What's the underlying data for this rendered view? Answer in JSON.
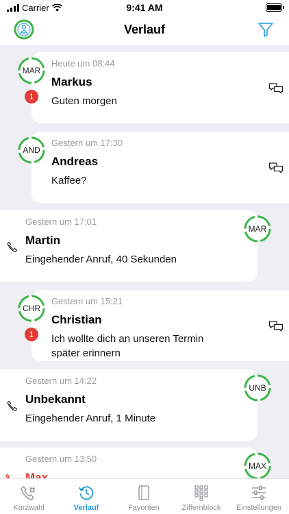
{
  "status_bar": {
    "carrier": "Carrier",
    "time": "9:41 AM"
  },
  "header": {
    "title": "Verlauf",
    "left_icon": "user-avatar-icon",
    "right_icon": "filter-icon"
  },
  "entries": [
    {
      "type": "message",
      "timestamp": "Heute um 08:44",
      "initials": "MAR",
      "name": "Markus",
      "text": "Guten morgen",
      "badge": "1"
    },
    {
      "type": "message",
      "timestamp": "Gestern um 17:30",
      "initials": "AND",
      "name": "Andreas",
      "text": "Kaffee?"
    },
    {
      "type": "call",
      "timestamp": "Gestern um 17:01",
      "initials": "MAR",
      "name": "Martin",
      "text": "Eingehender Anruf, 40 Sekunden"
    },
    {
      "type": "message",
      "timestamp": "Gestern um 15:21",
      "initials": "CHR",
      "name": "Christian",
      "text_line1": "Ich wollte dich an unseren Termin",
      "text_line2": "später erinnern",
      "badge": "1"
    },
    {
      "type": "call",
      "timestamp": "Gestern um 14:22",
      "initials": "UNB",
      "name": "Unbekannt",
      "text": "Eingehender Anruf, 1 Minute"
    },
    {
      "type": "call-missed",
      "timestamp": "Gestern um 13:50",
      "initials": "MAX",
      "name": "Max"
    }
  ],
  "tabs": [
    {
      "label": "Kurzwahl",
      "icon": "speed-dial-icon"
    },
    {
      "label": "Verlauf",
      "icon": "history-icon",
      "active": true
    },
    {
      "label": "Favoriten",
      "icon": "favorites-icon"
    },
    {
      "label": "Ziffernblock",
      "icon": "keypad-icon"
    },
    {
      "label": "Einstellungen",
      "icon": "settings-icon"
    }
  ],
  "colors": {
    "accent": "#1f9bd8",
    "presence_green": "#3db54a",
    "badge_red": "#e23b33",
    "background": "#efeef4"
  }
}
